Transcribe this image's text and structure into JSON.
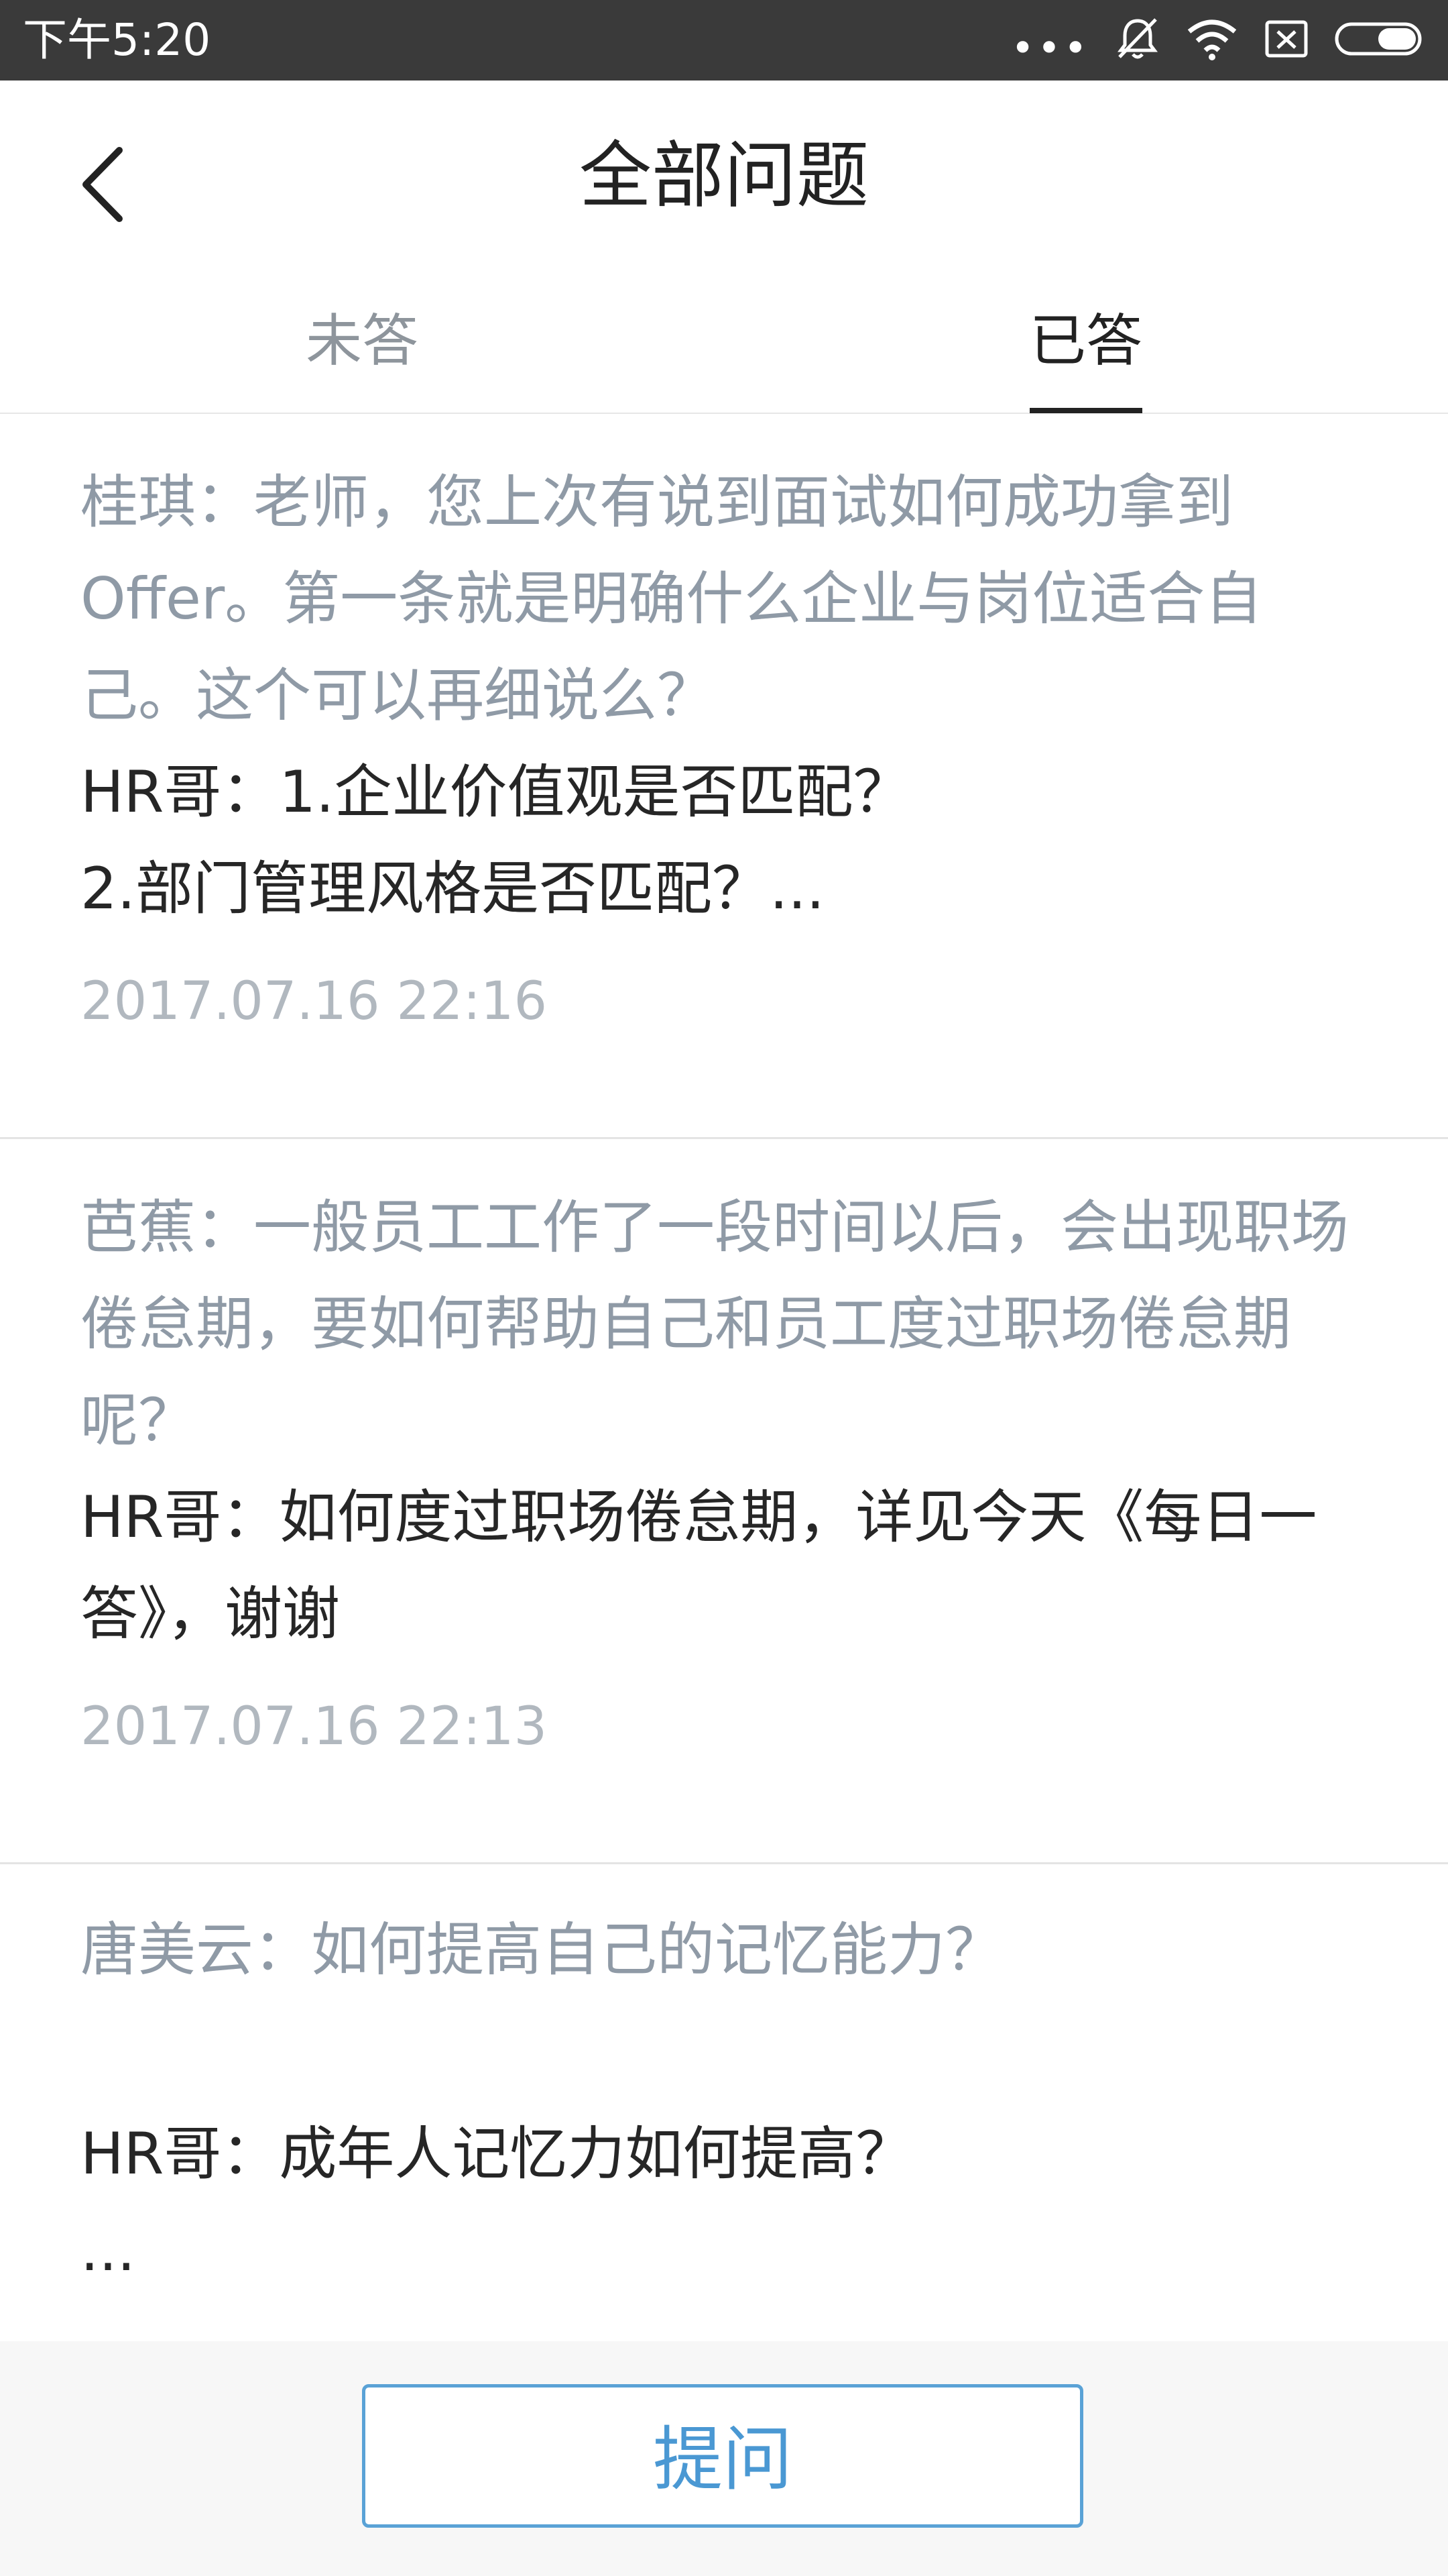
{
  "status_bar": {
    "time": "下午5:20",
    "icons": [
      "more-dots-icon",
      "mute-icon",
      "wifi-icon",
      "sim-x-icon",
      "battery-icon"
    ]
  },
  "header": {
    "title": "全部问题",
    "back_icon": "chevron-left-icon"
  },
  "tabs": [
    {
      "label": "未答",
      "active": false
    },
    {
      "label": "已答",
      "active": true
    }
  ],
  "items": [
    {
      "question": "桂琪：老师，您上次有说到面试如何成功拿到Offer。第一条就是明确什么企业与岗位适合自己。这个可以再细说么？",
      "answer": "HR哥：1.企业价值观是否匹配？\n2.部门管理风格是否匹配？...",
      "time": "2017.07.16  22:16"
    },
    {
      "question": "芭蕉：一般员工工作了一段时间以后，会出现职场倦怠期，要如何帮助自己和员工度过职场倦怠期呢？",
      "answer": "HR哥：如何度过职场倦怠期，详见今天《每日一答》，谢谢",
      "time": "2017.07.16  22:13"
    },
    {
      "question": "唐美云：如何提高自己的记忆能力？",
      "answer": "HR哥：成年人记忆力如何提高？\n...",
      "time": ""
    }
  ],
  "ask_button": {
    "label": "提问"
  },
  "colors": {
    "status_bar_bg": "#3a3a3a",
    "question_text": "#8f9aa6",
    "answer_text": "#262626",
    "time_text": "#b1b8bf",
    "accent_blue": "#4a98d3"
  }
}
